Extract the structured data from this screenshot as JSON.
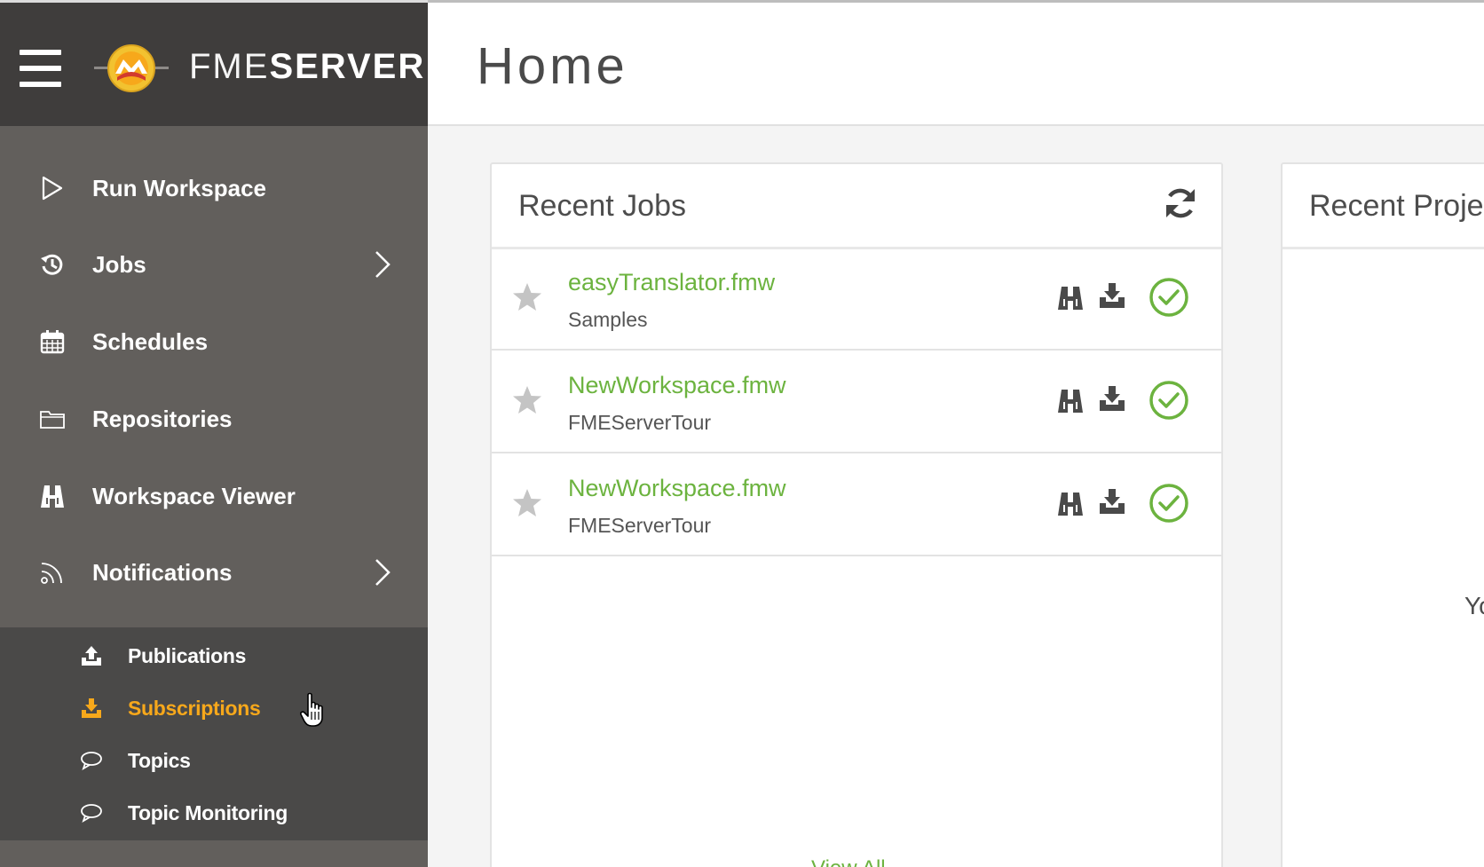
{
  "brand": {
    "light": "FME",
    "bold": "SERVER"
  },
  "page": {
    "title": "Home"
  },
  "colors": {
    "accent_green": "#6cb33f",
    "accent_orange": "#f7a81b",
    "sidebar_bg": "#625f5c",
    "brand_bg": "#3f3d3c",
    "subnav_bg": "#4a4948"
  },
  "sidebar": {
    "items": [
      {
        "label": "Run Workspace",
        "icon": "play-icon",
        "expandable": false
      },
      {
        "label": "Jobs",
        "icon": "history-icon",
        "expandable": true
      },
      {
        "label": "Schedules",
        "icon": "calendar-icon",
        "expandable": false
      },
      {
        "label": "Repositories",
        "icon": "folder-icon",
        "expandable": false
      },
      {
        "label": "Workspace Viewer",
        "icon": "binoculars-icon",
        "expandable": false
      },
      {
        "label": "Notifications",
        "icon": "rss-icon",
        "expandable": true
      }
    ],
    "subitems": [
      {
        "label": "Publications",
        "icon": "upload-icon",
        "active": false
      },
      {
        "label": "Subscriptions",
        "icon": "download-icon",
        "active": true
      },
      {
        "label": "Topics",
        "icon": "speech-bubble-icon",
        "active": false
      },
      {
        "label": "Topic Monitoring",
        "icon": "speech-bubble-icon",
        "active": false
      }
    ]
  },
  "recent_jobs": {
    "title": "Recent Jobs",
    "jobs": [
      {
        "name": "easyTranslator.fmw",
        "repository": "Samples",
        "status": "success"
      },
      {
        "name": "NewWorkspace.fmw",
        "repository": "FMEServerTour",
        "status": "success"
      },
      {
        "name": "NewWorkspace.fmw",
        "repository": "FMEServerTour",
        "status": "success"
      }
    ],
    "view_all": "View All"
  },
  "recent_projects": {
    "title": "Recent Proje",
    "message": "Yo"
  }
}
